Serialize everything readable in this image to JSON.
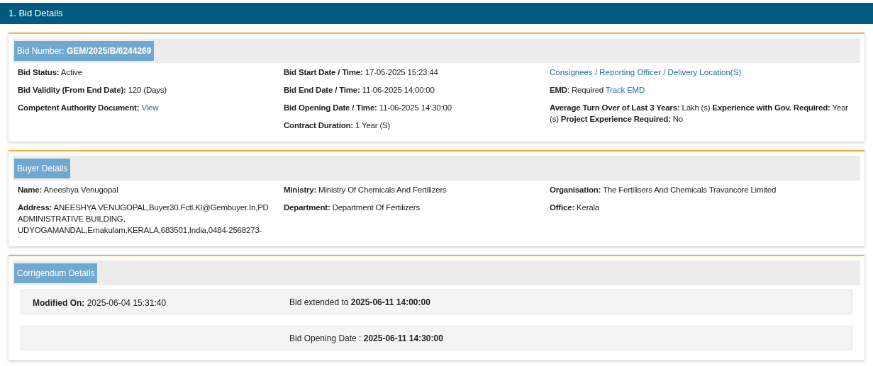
{
  "header": {
    "title": "1. Bid Details"
  },
  "sections": [
    {
      "title": "Bid Number: **GEM/2025/B/6244269**",
      "columns": [
        [
          {
            "text": "**Bid Status:** Active"
          },
          {
            "text": "**Bid Validity (From End Date):** 120 (Days)"
          },
          {
            "text": "**Competent Authority Document:**",
            "link": "View"
          }
        ],
        [
          {
            "text": "**Bid Start Date / Time:** 17-05-2025 15:23:44"
          },
          {
            "text": "**Bid End Date / Time:** 11-06-2025 14:00:00"
          },
          {
            "text": "**Bid Opening Date / Time:** 11-06-2025 14:30:00"
          },
          {
            "text": "**Contract Duration:**  1 Year (S)"
          }
        ],
        [
          {
            "link": "Consignees / Reporting Officer / Delivery Location(S)"
          },
          {
            "text": "**EMD**: Required",
            "link": "Track EMD"
          },
          {
            "text": "**Average Turn Over of Last 3 Years:** Lakh (s) **Experience with Gov. Required:** Year (s) **Project Experience Required:** No"
          }
        ]
      ]
    },
    {
      "title": "Buyer Details",
      "columns": [
        [
          {
            "text": "**Name:** Aneeshya Venugopal"
          },
          {
            "text": "**Address:** ANEESHYA VENUGOPAL,Buyer30.Fctl.Kl@Gembuyer.In,PD ADMINISTRATIVE BUILDING, UDYOGAMANDAL,Ernakulam,KERALA,683501,India,0484-2568273-"
          }
        ],
        [
          {
            "text": "**Ministry:** Ministry Of Chemicals And Fertilizers"
          },
          {
            "text": "**Department:** Department Of Fertilizers"
          }
        ],
        [
          {
            "text": "**Organisation:** The Fertilisers And Chemicals Travancore Limited"
          },
          {
            "text": "**Office:** Kerala"
          }
        ]
      ]
    }
  ],
  "corrigendum": {
    "title": "Corrigendum Details",
    "rows": [
      {
        "modified": "**Modified On:** 2025-06-04 15:31:40",
        "change": "Bid extended to **2025-06-11 14:00:00**"
      },
      {
        "change": "Bid Opening Date : **2025-06-11 14:30:00**"
      }
    ]
  }
}
